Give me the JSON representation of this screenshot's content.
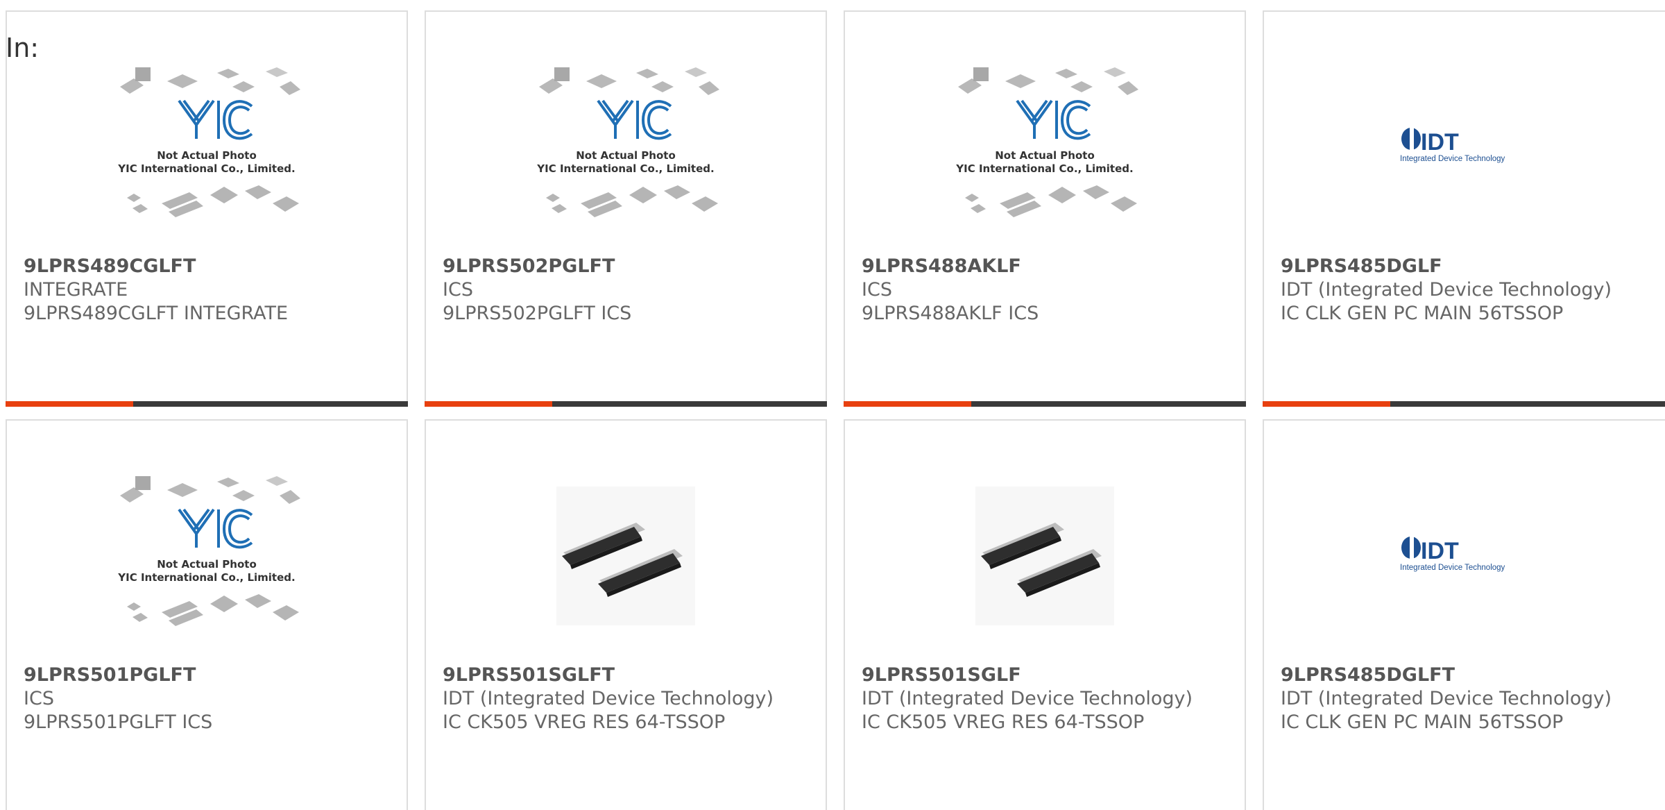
{
  "filter": {
    "label": "In:"
  },
  "products": [
    {
      "part_number": "9LPRS489CGLFT",
      "manufacturer": "INTEGRATE",
      "description": "9LPRS489CGLFT INTEGRATE",
      "image": "yic-placeholder-icon",
      "image_caption_line1": "Not Actual Photo",
      "image_caption_line2": "YIC International Co., Limited."
    },
    {
      "part_number": "9LPRS502PGLFT",
      "manufacturer": "ICS",
      "description": "9LPRS502PGLFT ICS",
      "image": "yic-placeholder-icon",
      "image_caption_line1": "Not Actual Photo",
      "image_caption_line2": "YIC International Co., Limited."
    },
    {
      "part_number": "9LPRS488AKLF",
      "manufacturer": "ICS",
      "description": "9LPRS488AKLF ICS",
      "image": "yic-placeholder-icon",
      "image_caption_line1": "Not Actual Photo",
      "image_caption_line2": "YIC International Co., Limited."
    },
    {
      "part_number": "9LPRS485DGLF",
      "manufacturer": "IDT (Integrated Device Technology)",
      "description": "IC CLK GEN PC MAIN 56TSSOP",
      "image": "idt-logo-icon",
      "logo_text": "IDT",
      "logo_tagline": "Integrated Device Technology"
    },
    {
      "part_number": "9LPRS501PGLFT",
      "manufacturer": "ICS",
      "description": "9LPRS501PGLFT ICS",
      "image": "yic-placeholder-icon",
      "image_caption_line1": "Not Actual Photo",
      "image_caption_line2": "YIC International Co., Limited."
    },
    {
      "part_number": "9LPRS501SGLFT",
      "manufacturer": "IDT (Integrated Device Technology)",
      "description": "IC CK505 VREG RES 64-TSSOP",
      "image": "tssop-chip-photo-icon"
    },
    {
      "part_number": "9LPRS501SGLF",
      "manufacturer": "IDT (Integrated Device Technology)",
      "description": "IC CK505 VREG RES 64-TSSOP",
      "image": "tssop-chip-photo-icon"
    },
    {
      "part_number": "9LPRS485DGLFT",
      "manufacturer": "IDT (Integrated Device Technology)",
      "description": "IC CLK GEN PC MAIN 56TSSOP",
      "image": "idt-logo-icon",
      "logo_text": "IDT",
      "logo_tagline": "Integrated Device Technology"
    }
  ],
  "colors": {
    "accent": "#e8400f",
    "bar": "#3a3a3a",
    "yic_blue": "#1f6fb5",
    "idt_blue": "#1d4f91"
  }
}
